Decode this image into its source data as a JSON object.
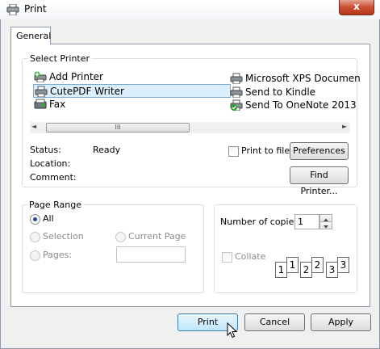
{
  "window": {
    "title": "Print",
    "close_label": "x"
  },
  "tabs": [
    {
      "label": "General"
    }
  ],
  "select_printer": {
    "label": "Select Printer",
    "printers_left": [
      "Add Printer",
      "CutePDF Writer",
      "Fax"
    ],
    "printers_right": [
      "Microsoft XPS Documen",
      "Send to Kindle",
      "Send To OneNote 2013"
    ],
    "selected": "CutePDF Writer",
    "scroll_left_glyph": "◄",
    "scroll_right_glyph": "►",
    "scroll_thumb_glyph": "III"
  },
  "status": {
    "status_label": "Status:",
    "status_value": "Ready",
    "location_label": "Location:",
    "comment_label": "Comment:"
  },
  "options": {
    "print_to_file_label": "Print to file",
    "preferences_label": "Preferences",
    "find_printer_label": "Find Printer..."
  },
  "page_range": {
    "label": "Page Range",
    "all_label": "All",
    "selection_label": "Selection",
    "current_page_label": "Current Page",
    "pages_label": "Pages:"
  },
  "copies": {
    "label": "Number of copies:",
    "value": "1",
    "collate_label": "Collate",
    "collate_numbers": [
      "1",
      "1",
      "2",
      "2",
      "3",
      "3"
    ]
  },
  "footer": {
    "print_label": "Print",
    "cancel_label": "Cancel",
    "apply_label": "Apply"
  }
}
